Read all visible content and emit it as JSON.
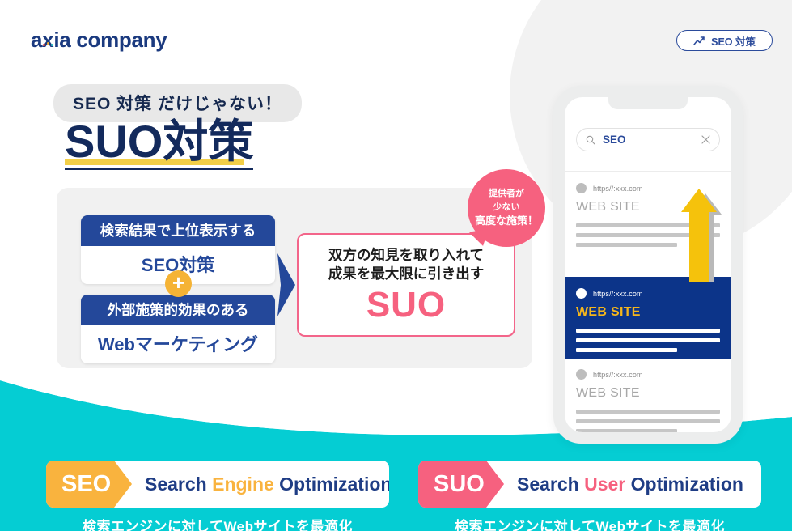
{
  "brand": {
    "logo_text_a": "a",
    "logo_text_b": "xia company"
  },
  "header": {
    "seo_pill_label": "SEO 対策",
    "seo_pill_icon": "trend-up-chart-icon"
  },
  "hero": {
    "bubble_text": "SEO 対策 だけじゃない！",
    "headline": "SUO対策"
  },
  "diagram": {
    "left_boxes": [
      {
        "top": "検索結果で上位表示する",
        "bottom": "SEO対策"
      },
      {
        "top": "外部施策的効果のある",
        "bottom": "Webマーケティング"
      }
    ],
    "plus_symbol": "+",
    "arrow_icon": "right-arrow-icon",
    "right_box": {
      "line1": "双方の知見を取り入れて",
      "line2": "成果を最大限に引き出す",
      "acronym": "SUO"
    },
    "pink_badge": {
      "line1": "提供者が",
      "line2": "少ない",
      "line3": "高度な施策！"
    }
  },
  "phone": {
    "search": {
      "icon": "search-icon",
      "value": "SEO",
      "clear_icon": "close-icon"
    },
    "results": [
      {
        "url": "https//:xxx.com",
        "title": "WEB SITE",
        "highlighted": false
      },
      {
        "url": "https//:xxx.com",
        "title": "WEB SITE",
        "highlighted": true
      },
      {
        "url": "https//:xxx.com",
        "title": "WEB SITE",
        "highlighted": false
      }
    ],
    "rank_arrow_icon": "up-arrow-icon"
  },
  "cards": [
    {
      "tag": "SEO",
      "title_word1": "Search",
      "title_word2": "Engine",
      "title_word3": "Optimization",
      "caption": "検索エンジンに対してWebサイトを最適化",
      "tag_color": "#f9b33e"
    },
    {
      "tag": "SUO",
      "title_word1": "Search",
      "title_word2": "User",
      "title_word3": "Optimization",
      "caption": "検索エンジンに対してWebサイトを最適化",
      "tag_color": "#f6617f"
    }
  ],
  "colors": {
    "navy": "#24489a",
    "deep_navy": "#132a5c",
    "pink": "#f6617f",
    "amber": "#f9b33e",
    "teal": "#05cdd3",
    "yellow_underline": "#f2cf48",
    "panel_gray": "#f1f1f1"
  }
}
